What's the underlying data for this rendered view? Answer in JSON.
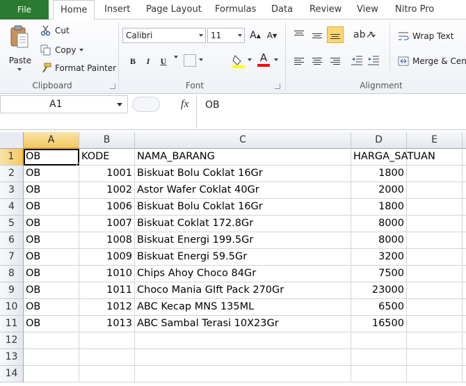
{
  "tabs": {
    "file": "File",
    "items": [
      "Home",
      "Insert",
      "Page Layout",
      "Formulas",
      "Data",
      "Review",
      "View",
      "Nitro Pro"
    ]
  },
  "clipboard": {
    "group_label": "Clipboard",
    "paste": "Paste",
    "cut": "Cut",
    "copy": "Copy",
    "format_painter": "Format Painter"
  },
  "font": {
    "group_label": "Font",
    "name": "Calibri",
    "size": "11",
    "bold": "B",
    "italic": "I",
    "underline": "U",
    "grow": "A",
    "shrink": "A"
  },
  "alignment": {
    "group_label": "Alignment",
    "wrap_text": "Wrap Text",
    "merge": "Merge & Center"
  },
  "formula_bar": {
    "name_box": "A1",
    "fx": "fx",
    "content": "OB"
  },
  "colors": {
    "file_tab": "#2a7a32",
    "selection_header": "#f3c862",
    "fill_highlight": "#ffff00",
    "font_color": "#ff0000"
  },
  "grid": {
    "columns": [
      "A",
      "B",
      "C",
      "D",
      "E"
    ],
    "rows": [
      {
        "n": "1",
        "a": "OB",
        "b": "KODE",
        "c": "NAMA_BARANG",
        "d": "HARGA_SATUAN"
      },
      {
        "n": "2",
        "a": "OB",
        "b": "1001",
        "c": "Biskuat Bolu Coklat 16Gr",
        "d": "1800"
      },
      {
        "n": "3",
        "a": "OB",
        "b": "1002",
        "c": "Astor Wafer Coklat 40Gr",
        "d": "2000"
      },
      {
        "n": "4",
        "a": "OB",
        "b": "1006",
        "c": "Biskuat Bolu Coklat 16Gr",
        "d": "1800"
      },
      {
        "n": "5",
        "a": "OB",
        "b": "1007",
        "c": "Biskuat Coklat 172.8Gr",
        "d": "8000"
      },
      {
        "n": "6",
        "a": "OB",
        "b": "1008",
        "c": "Biskuat Energi 199.5Gr",
        "d": "8000"
      },
      {
        "n": "7",
        "a": "OB",
        "b": "1009",
        "c": "Biskuat Energi 59.5Gr",
        "d": "3200"
      },
      {
        "n": "8",
        "a": "OB",
        "b": "1010",
        "c": "Chips Ahoy Choco 84Gr",
        "d": "7500"
      },
      {
        "n": "9",
        "a": "OB",
        "b": "1011",
        "c": "Choco Mania GIft Pack 270Gr",
        "d": "23000"
      },
      {
        "n": "10",
        "a": "OB",
        "b": "1012",
        "c": "ABC Kecap MNS 135ML",
        "d": "6500"
      },
      {
        "n": "11",
        "a": "OB",
        "b": "1013",
        "c": "ABC Sambal Terasi 10X23Gr",
        "d": "16500"
      },
      {
        "n": "12",
        "a": "",
        "b": "",
        "c": "",
        "d": ""
      },
      {
        "n": "13",
        "a": "",
        "b": "",
        "c": "",
        "d": ""
      },
      {
        "n": "14",
        "a": "",
        "b": "",
        "c": "",
        "d": ""
      }
    ]
  }
}
